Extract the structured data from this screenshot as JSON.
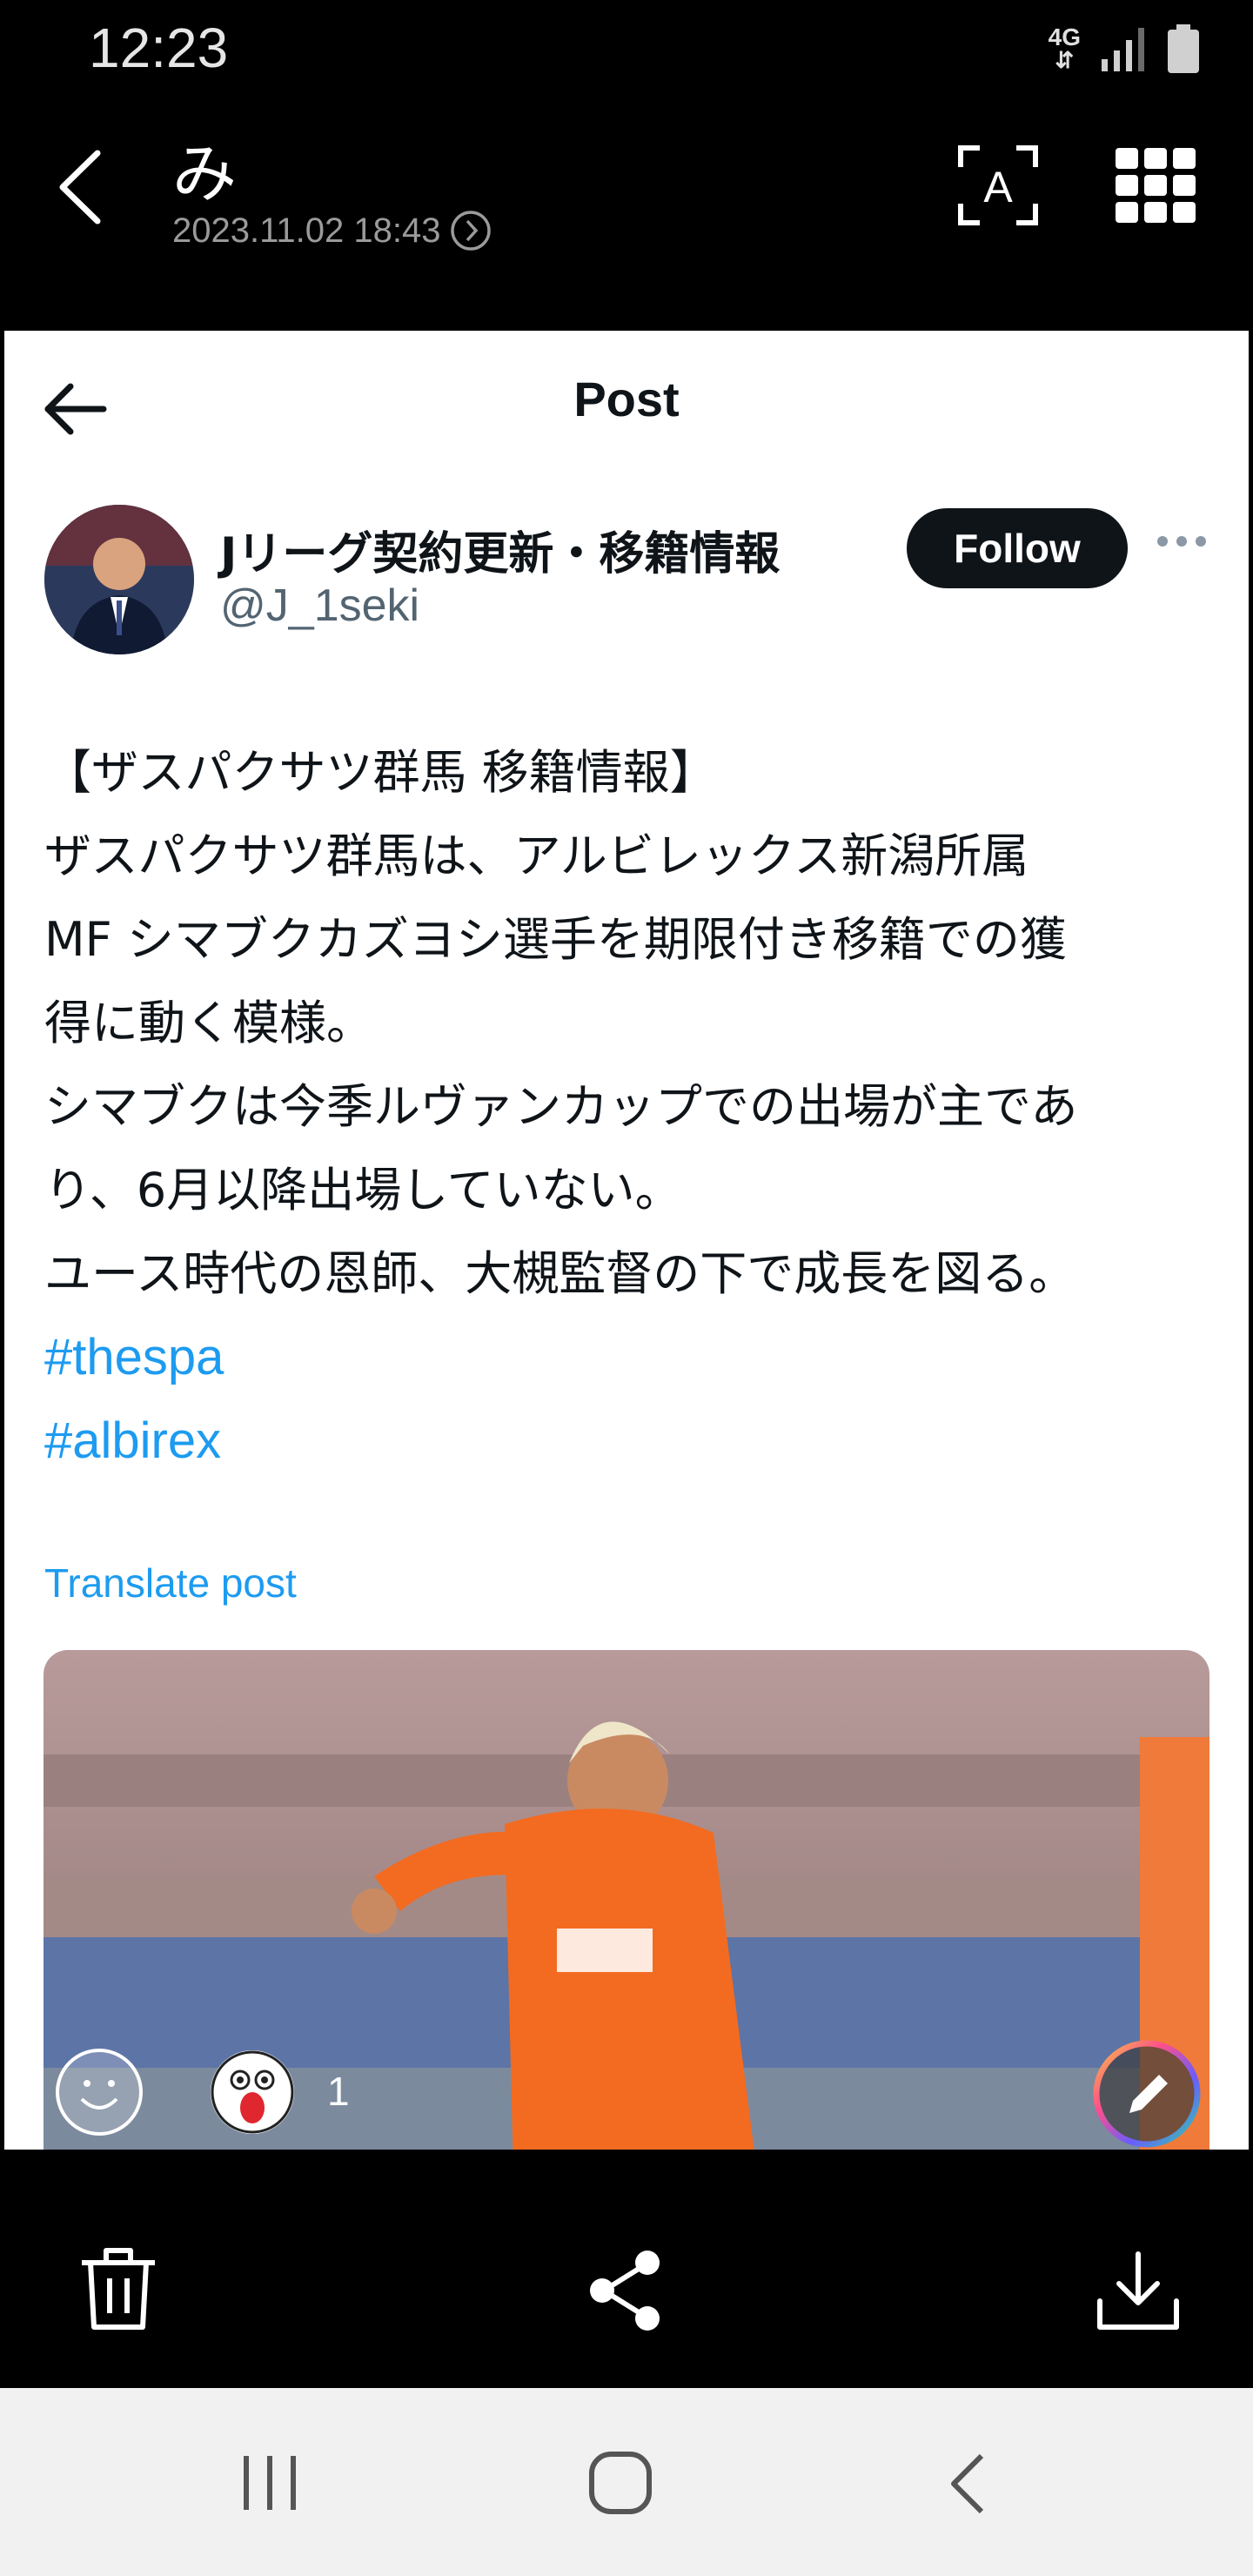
{
  "status_bar": {
    "time": "12:23",
    "network": "4G"
  },
  "header": {
    "title": "み",
    "date": "2023.11.02 18:43"
  },
  "post": {
    "page_title": "Post",
    "account_name": "Jリーグ契約更新・移籍情報",
    "account_handle": "@J_1seki",
    "follow_label": "Follow",
    "body_lines": [
      "【ザスパクサツ群馬 移籍情報】",
      "ザスパクサツ群馬は、アルビレックス新潟所属",
      "MF シマブクカズヨシ選手を期限付き移籍での獲",
      "得に動く模様。",
      "シマブクは今季ルヴァンカップでの出場が主であ",
      "り、6月以降出場していない。",
      "ユース時代の恩師、大槻監督の下で成長を図る。"
    ],
    "hashtags": [
      "#thespa",
      "#albirex"
    ],
    "translate_label": "Translate post"
  },
  "reactions": {
    "count": "1"
  },
  "colors": {
    "link": "#1d9bf0",
    "text": "#0f1419",
    "secondary": "#536471",
    "jersey": "#f26b21"
  }
}
